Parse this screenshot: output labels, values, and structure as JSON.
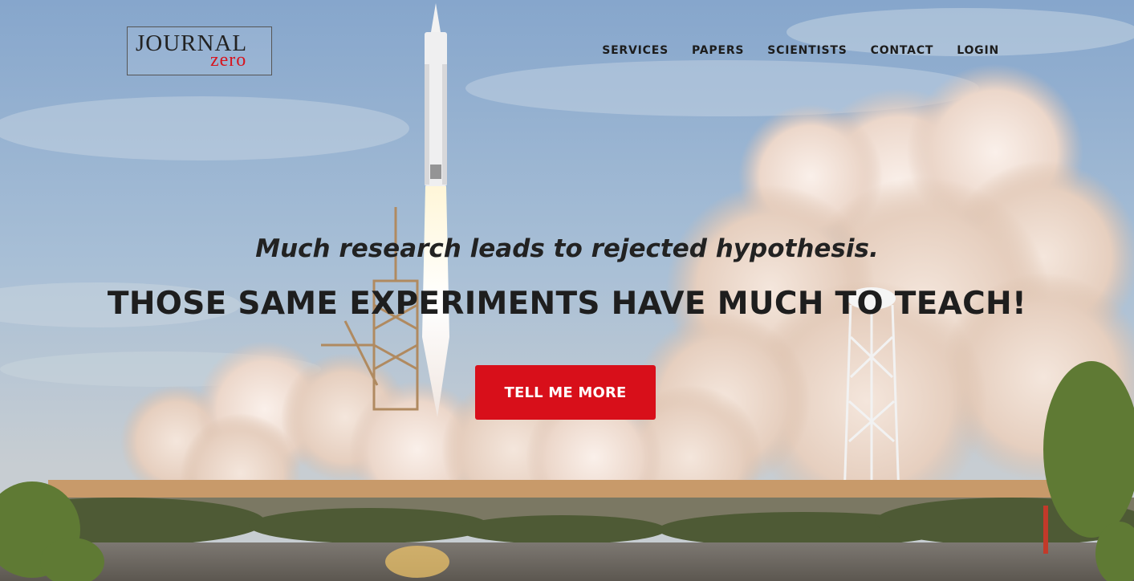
{
  "brand": {
    "logo_line1": "JOURNAL",
    "logo_line2": "zero"
  },
  "nav": {
    "items": [
      "SERVICES",
      "PAPERS",
      "SCIENTISTS",
      "CONTACT",
      "LOGIN"
    ]
  },
  "hero": {
    "tagline": "Much research leads to rejected hypothesis.",
    "headline": "THOSE SAME EXPERIMENTS HAVE MUCH TO TEACH!",
    "cta_label": "TELL ME MORE"
  },
  "colors": {
    "accent": "#d80f1a",
    "text": "#1e1e1e",
    "logo_red": "#d7141e"
  }
}
